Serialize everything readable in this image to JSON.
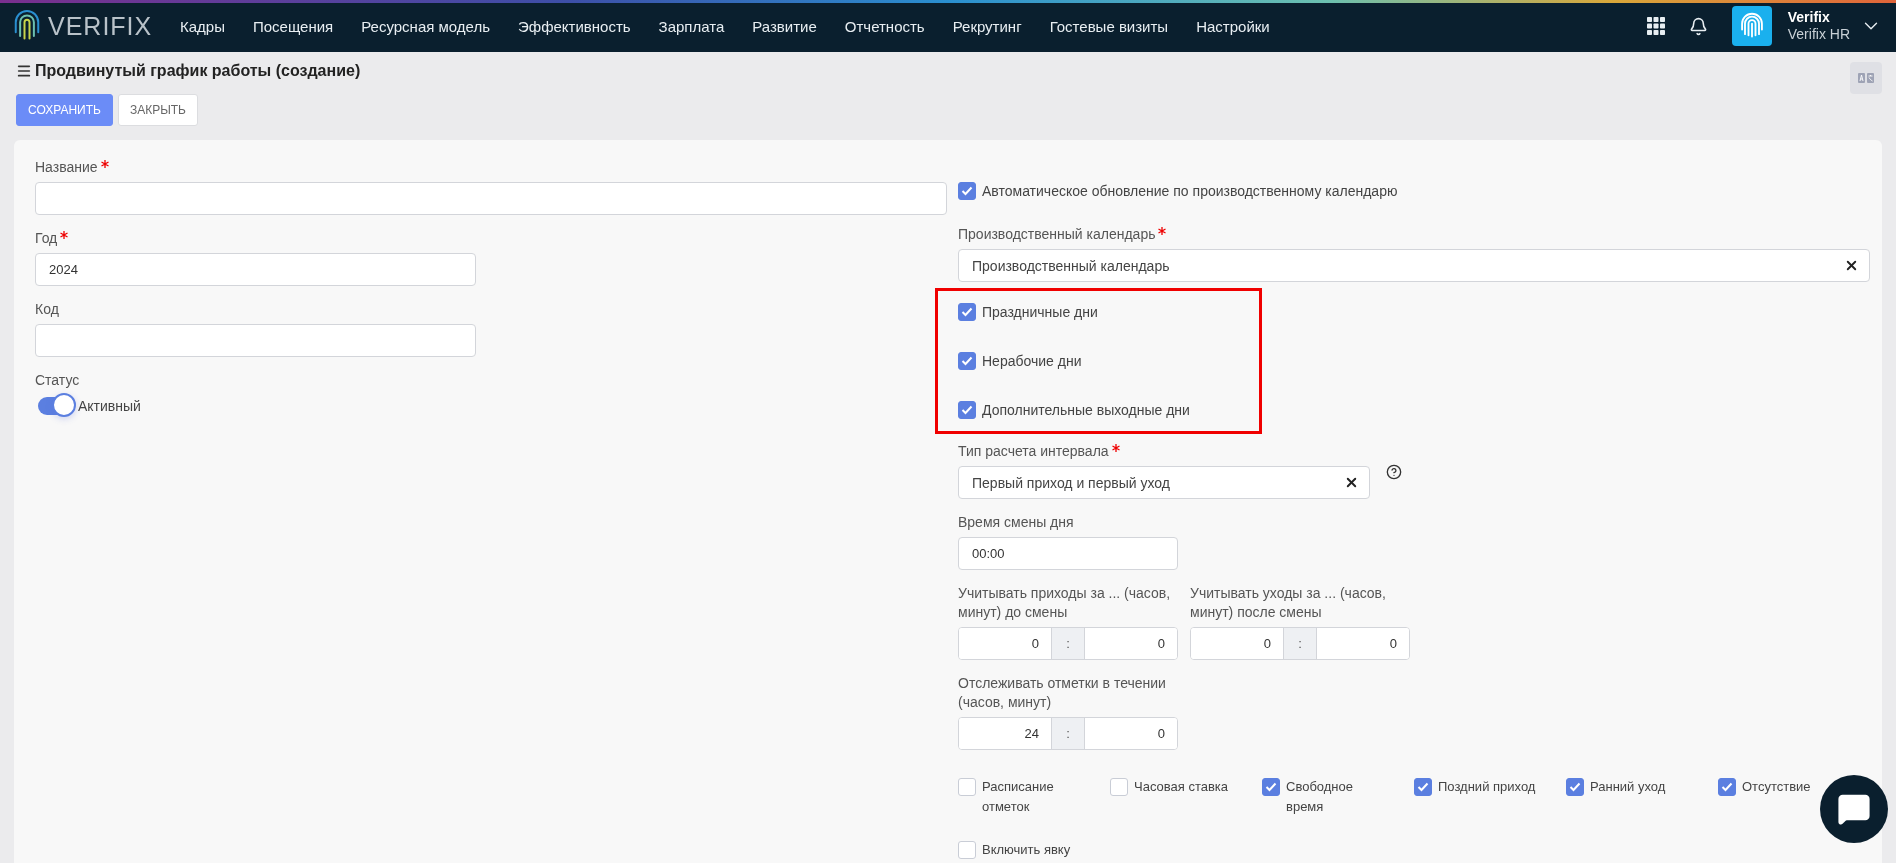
{
  "nav": {
    "logo": "VERIFIX",
    "items": [
      {
        "label": "Кадры"
      },
      {
        "label": "Посещения"
      },
      {
        "label": "Ресурсная модель"
      },
      {
        "label": "Эффективность"
      },
      {
        "label": "Зарплата"
      },
      {
        "label": "Развитие"
      },
      {
        "label": "Отчетность"
      },
      {
        "label": "Рекрутинг"
      },
      {
        "label": "Гостевые визиты"
      },
      {
        "label": "Настройки"
      }
    ],
    "user": {
      "name": "Verifix",
      "company": "Verifix HR"
    }
  },
  "page": {
    "title": "Продвинутый график работы (создание)",
    "buttons": [
      {
        "label": "СОХРАНИТЬ",
        "kind": "primary"
      },
      {
        "label": "ЗАКРЫТЬ",
        "kind": "secondary"
      }
    ]
  },
  "left": {
    "name": {
      "label": "Название",
      "required": true
    },
    "year": {
      "label": "Год",
      "required": true,
      "value": "2024"
    },
    "code": {
      "label": "Код",
      "required": false
    },
    "status": {
      "label": "Статус",
      "on": true,
      "text": "Активный"
    }
  },
  "right": {
    "auto_update": {
      "label": "Автоматическое обновление по производственному календарю",
      "checked": true
    },
    "calendar": {
      "label": "Производственный календарь",
      "required": true,
      "value": "Производственный календарь"
    },
    "day_types": {
      "highlighted": true,
      "items": [
        {
          "label": "Праздничные дни",
          "checked": true
        },
        {
          "label": "Нерабочие дни",
          "checked": true
        },
        {
          "label": "Дополнительные выходные дни",
          "checked": true
        }
      ]
    },
    "interval_type": {
      "label": "Тип расчета интервала",
      "required": true,
      "value": "Первый приход и первый уход"
    },
    "day_change_time": {
      "label": "Время смены дня",
      "value": "00:00"
    },
    "ranges": [
      {
        "label": "Учитывать приходы за ... (часов, минут) до смены",
        "hours": "0",
        "separator": ":",
        "minutes": "0"
      },
      {
        "label": "Учитывать уходы за ... (часов, минут) после смены",
        "hours": "0",
        "separator": ":",
        "minutes": "0"
      }
    ],
    "tracking": {
      "label": "Отслеживать отметки в течении (часов, минут)",
      "hours": "24",
      "separator": ":",
      "minutes": "0"
    },
    "flags": [
      {
        "label": "Расписание отметок",
        "checked": false
      },
      {
        "label": "Часовая ставка",
        "checked": false
      },
      {
        "label": "Свободное время",
        "checked": true
      },
      {
        "label": "Поздний приход",
        "checked": true
      },
      {
        "label": "Ранний уход",
        "checked": true
      },
      {
        "label": "Отсутствие",
        "checked": true
      },
      {
        "label": "Включить явку",
        "checked": false
      }
    ]
  }
}
